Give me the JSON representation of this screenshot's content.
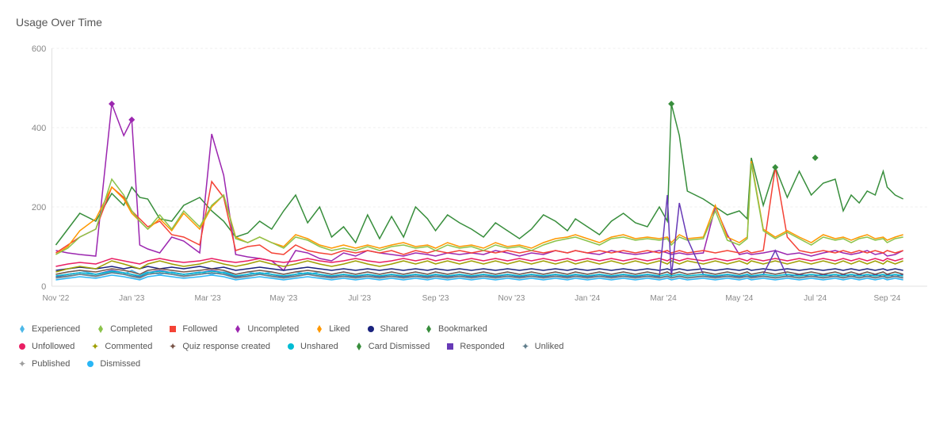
{
  "title": "Usage Over Time",
  "chart": {
    "xLabels": [
      "Nov '22",
      "Jan '23",
      "Mar '23",
      "May '23",
      "Jul '23",
      "Sep '23",
      "Nov '23",
      "Jan '24",
      "Mar '24",
      "May '24",
      "Jul '24",
      "Sep '24"
    ],
    "yLabels": [
      "0",
      "200",
      "400",
      "600"
    ],
    "yMax": 600,
    "yTicks": [
      0,
      200,
      400,
      600
    ]
  },
  "legend": [
    {
      "label": "Experienced",
      "color": "#4db8e8",
      "shape": "diamond"
    },
    {
      "label": "Completed",
      "color": "#8bc34a",
      "shape": "diamond"
    },
    {
      "label": "Followed",
      "color": "#f44336",
      "shape": "square"
    },
    {
      "label": "Uncompleted",
      "color": "#9c27b0",
      "shape": "diamond"
    },
    {
      "label": "Liked",
      "color": "#ff9800",
      "shape": "diamond"
    },
    {
      "label": "Shared",
      "color": "#1a237e",
      "shape": "dot"
    },
    {
      "label": "Bookmarked",
      "color": "#4caf50",
      "shape": "diamond"
    },
    {
      "label": "Unfollowed",
      "color": "#e91e63",
      "shape": "dot"
    },
    {
      "label": "Commented",
      "color": "#9e9e00",
      "shape": "star"
    },
    {
      "label": "Quiz response created",
      "color": "#795548",
      "shape": "star"
    },
    {
      "label": "Unshared",
      "color": "#00bcd4",
      "shape": "dot"
    },
    {
      "label": "Card Dismissed",
      "color": "#388e3c",
      "shape": "diamond"
    },
    {
      "label": "Responded",
      "color": "#673ab7",
      "shape": "square"
    },
    {
      "label": "Unliked",
      "color": "#607d8b",
      "shape": "star"
    },
    {
      "label": "Published",
      "color": "#9e9e9e",
      "shape": "star"
    },
    {
      "label": "Dismissed",
      "color": "#29b6f6",
      "shape": "dot"
    }
  ]
}
